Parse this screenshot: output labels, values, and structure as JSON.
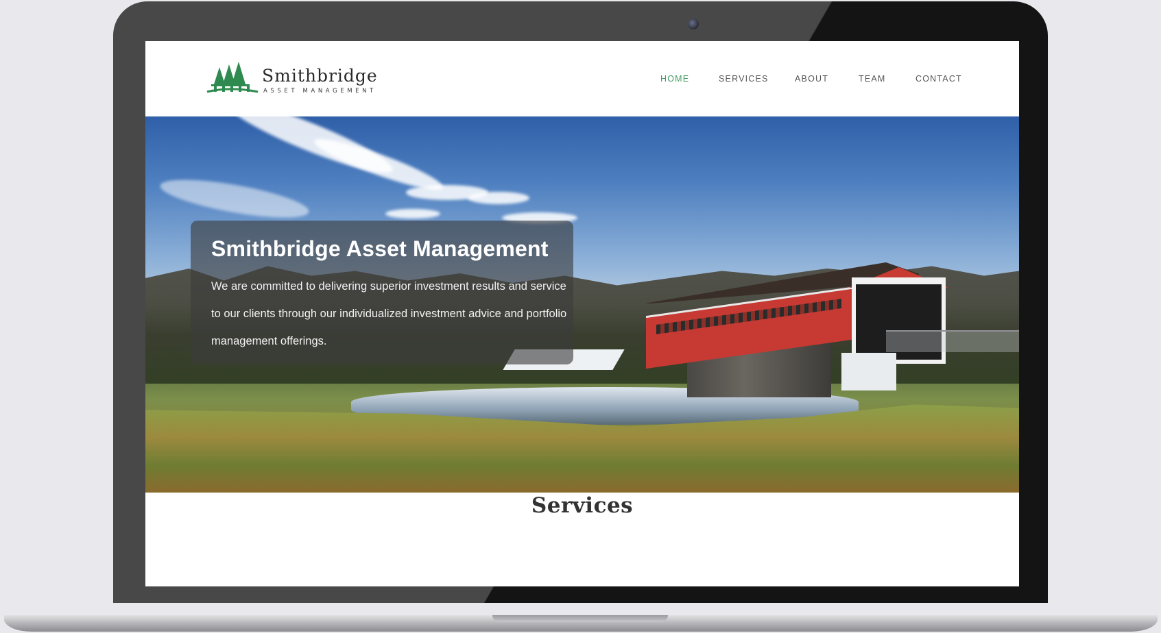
{
  "brand": {
    "name": "Smithbridge",
    "subtitle": "ASSET MANAGEMENT",
    "color": "#2f8a4f"
  },
  "nav": {
    "items": [
      {
        "label": "HOME",
        "active": true
      },
      {
        "label": "SERVICES",
        "active": false
      },
      {
        "label": "ABOUT",
        "active": false
      },
      {
        "label": "TEAM",
        "active": false
      },
      {
        "label": "CONTACT",
        "active": false
      }
    ],
    "active_color": "#3e9a61"
  },
  "hero": {
    "title": "Smithbridge Asset Management",
    "text": "We are committed to delivering superior investment results and service to our clients through our individualized investment advice and portfolio management offerings."
  },
  "services": {
    "heading": "Services"
  }
}
